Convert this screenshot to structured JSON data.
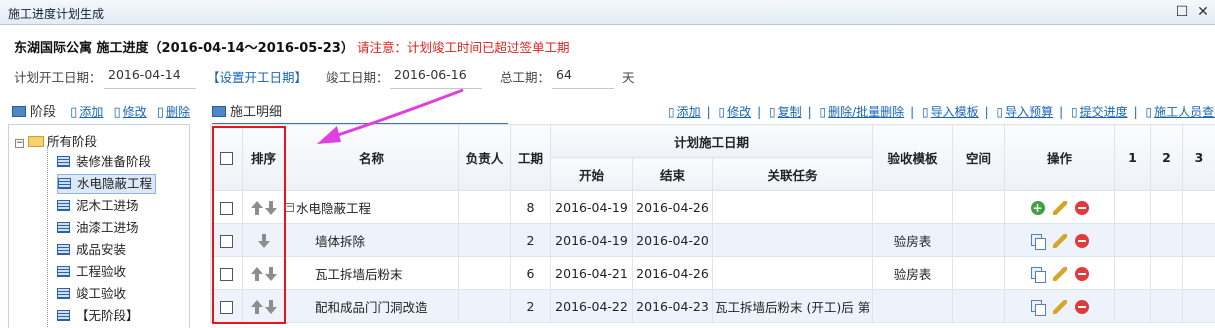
{
  "window": {
    "title": "施工进度计划生成",
    "restore_glyph": "☐",
    "close_glyph": "✕"
  },
  "header": {
    "project_info": "东湖国际公寓 施工进度（2016-04-14～2016-05-23）",
    "warning": "请注意：计划竣工时间已超过签单工期"
  },
  "plan": {
    "start_label": "计划开工日期：",
    "start_value": "2016-04-14",
    "set_start_link": "【设置开工日期】",
    "finish_label": "竣工日期：",
    "finish_value": "2016-06-16",
    "duration_label": "总工期：",
    "duration_value": "64",
    "duration_unit": "天"
  },
  "stage_panel": {
    "title": "阶段",
    "actions": [
      "添加",
      "修改",
      "删除"
    ]
  },
  "detail_panel": {
    "title": "施工明细",
    "actions": [
      "添加",
      "修改",
      "复制",
      "删除/批量删除",
      "导入模板",
      "导入预算",
      "提交进度",
      "施工人员查看"
    ]
  },
  "tree": {
    "root": "所有阶段",
    "root_toggle": "−",
    "nodes": [
      {
        "label": "装修准备阶段"
      },
      {
        "label": "水电隐蔽工程",
        "selected": true
      },
      {
        "label": "泥木工进场"
      },
      {
        "label": "油漆工进场"
      },
      {
        "label": "成品安装"
      },
      {
        "label": "工程验收"
      },
      {
        "label": "竣工验收"
      },
      {
        "label": "【无阶段】"
      }
    ]
  },
  "grid": {
    "headers": {
      "sort": "排序",
      "name": "名称",
      "owner": "负责人",
      "duration": "工期",
      "planned_dates": "计划施工日期",
      "start": "开始",
      "end": "结束",
      "linked": "关联任务",
      "template": "验收模板",
      "space": "空间",
      "ops": "操作",
      "day1": "1",
      "day2": "2",
      "day3": "3"
    },
    "rows": [
      {
        "name": "水电隐蔽工程",
        "group": true,
        "toggle": "−",
        "duration": "8",
        "start": "2016-04-19",
        "end": "2016-04-26",
        "linked": "",
        "template": "",
        "sort": [
          "up",
          "down"
        ],
        "ops": [
          "add-icon",
          "edit-icon",
          "delete-icon"
        ]
      },
      {
        "name": "墙体拆除",
        "duration": "2",
        "start": "2016-04-19",
        "end": "2016-04-20",
        "linked": "",
        "template": "验房表",
        "sort": [
          "down"
        ],
        "ops": [
          "copy-icon",
          "edit-icon",
          "delete-icon"
        ]
      },
      {
        "name": "瓦工拆墙后粉末",
        "duration": "6",
        "start": "2016-04-21",
        "end": "2016-04-26",
        "linked": "",
        "template": "验房表",
        "sort": [
          "up",
          "down"
        ],
        "ops": [
          "copy-icon",
          "edit-icon",
          "delete-icon"
        ]
      },
      {
        "name": "配和成品门门洞改造",
        "duration": "2",
        "start": "2016-04-22",
        "end": "2016-04-23",
        "linked": "瓦工拆墙后粉末 (开工)后 第",
        "template": "",
        "sort": [
          "up",
          "down"
        ],
        "ops": [
          "copy-icon",
          "edit-icon",
          "delete-icon"
        ]
      }
    ]
  },
  "colors": {
    "highlight_box": "#e8151b",
    "annotation_arrow": "#e040e0",
    "link": "#1766b5",
    "warning": "#e3211c"
  }
}
